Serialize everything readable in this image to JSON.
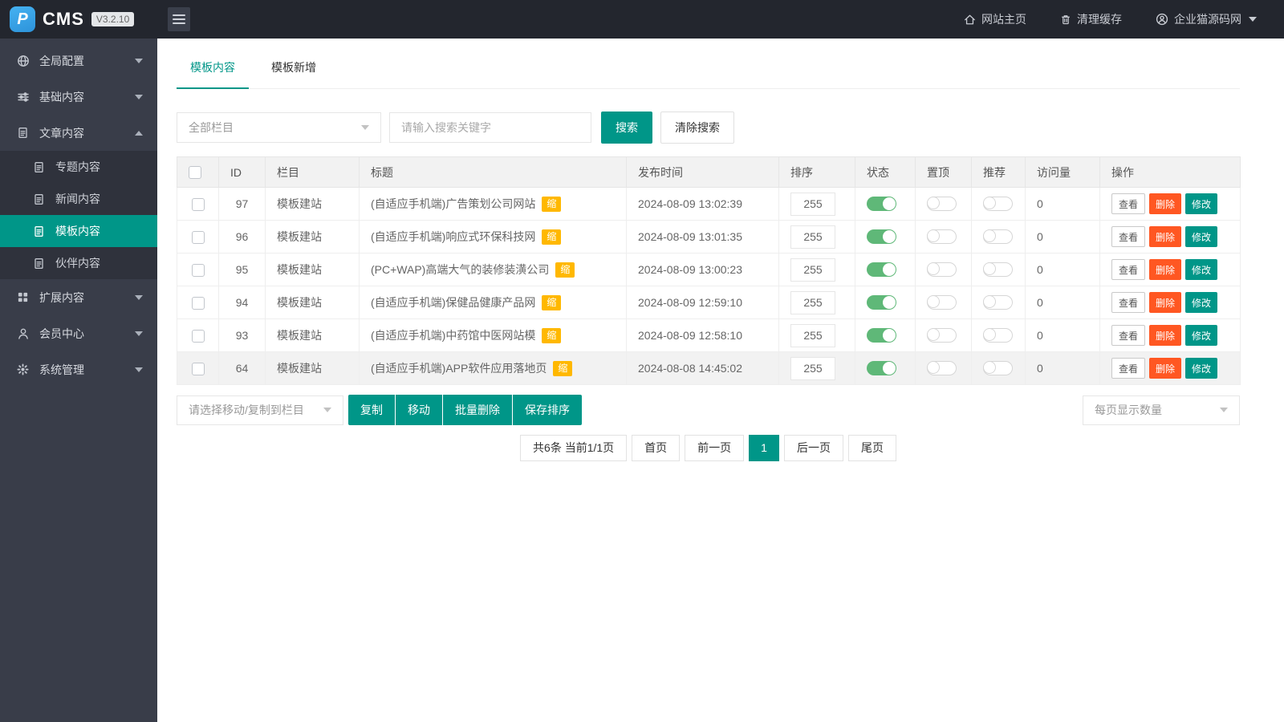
{
  "topbar": {
    "logo_letter": "P",
    "logo_text": "CMS",
    "version": "V3.2.10",
    "links": [
      {
        "label": "网站主页",
        "icon": "home-icon"
      },
      {
        "label": "清理缓存",
        "icon": "trash-icon"
      },
      {
        "label": "企业猫源码网",
        "icon": "user-circle-icon",
        "caret": true
      }
    ]
  },
  "sidebar": {
    "items": [
      {
        "label": "全局配置",
        "icon": "globe-icon",
        "caret": "down"
      },
      {
        "label": "基础内容",
        "icon": "sliders-icon",
        "caret": "down"
      },
      {
        "label": "文章内容",
        "icon": "file-icon",
        "caret": "up",
        "expanded": true,
        "children": [
          {
            "label": "专题内容",
            "icon": "file-icon"
          },
          {
            "label": "新闻内容",
            "icon": "file-icon"
          },
          {
            "label": "模板内容",
            "icon": "file-icon",
            "active": true
          },
          {
            "label": "伙伴内容",
            "icon": "file-icon"
          }
        ]
      },
      {
        "label": "扩展内容",
        "icon": "grid-icon",
        "caret": "down"
      },
      {
        "label": "会员中心",
        "icon": "user-icon",
        "caret": "down"
      },
      {
        "label": "系统管理",
        "icon": "gear-icon",
        "caret": "down"
      }
    ]
  },
  "tabs": [
    {
      "label": "模板内容",
      "active": true
    },
    {
      "label": "模板新增",
      "active": false
    }
  ],
  "filters": {
    "category_select_value": "全部栏目",
    "search_placeholder": "请输入搜索关键字",
    "search_button": "搜索",
    "clear_button": "清除搜索"
  },
  "table": {
    "columns": [
      "ID",
      "栏目",
      "标题",
      "发布时间",
      "排序",
      "状态",
      "置顶",
      "推荐",
      "访问量",
      "操作"
    ],
    "actions": [
      "查看",
      "删除",
      "修改"
    ],
    "rows": [
      {
        "id": "97",
        "category": "模板建站",
        "title": "(自适应手机端)广告策划公司网站",
        "badge": "缩",
        "time": "2024-08-09 13:02:39",
        "sort": "255",
        "status": true,
        "pinned": false,
        "recommended": false,
        "visits": "0",
        "highlighted": false
      },
      {
        "id": "96",
        "category": "模板建站",
        "title": "(自适应手机端)响应式环保科技网",
        "badge": "缩",
        "time": "2024-08-09 13:01:35",
        "sort": "255",
        "status": true,
        "pinned": false,
        "recommended": false,
        "visits": "0",
        "highlighted": false
      },
      {
        "id": "95",
        "category": "模板建站",
        "title": "(PC+WAP)高端大气的装修装潢公司",
        "badge": "缩",
        "time": "2024-08-09 13:00:23",
        "sort": "255",
        "status": true,
        "pinned": false,
        "recommended": false,
        "visits": "0",
        "highlighted": false
      },
      {
        "id": "94",
        "category": "模板建站",
        "title": "(自适应手机端)保健品健康产品网",
        "badge": "缩",
        "time": "2024-08-09 12:59:10",
        "sort": "255",
        "status": true,
        "pinned": false,
        "recommended": false,
        "visits": "0",
        "highlighted": false
      },
      {
        "id": "93",
        "category": "模板建站",
        "title": "(自适应手机端)中药馆中医网站模",
        "badge": "缩",
        "time": "2024-08-09 12:58:10",
        "sort": "255",
        "status": true,
        "pinned": false,
        "recommended": false,
        "visits": "0",
        "highlighted": false
      },
      {
        "id": "64",
        "category": "模板建站",
        "title": "(自适应手机端)APP软件应用落地页",
        "badge": "缩",
        "time": "2024-08-08 14:45:02",
        "sort": "255",
        "status": true,
        "pinned": false,
        "recommended": false,
        "visits": "0",
        "highlighted": true
      }
    ]
  },
  "bulkbar": {
    "select_placeholder": "请选择移动/复制到栏目",
    "buttons": [
      "复制",
      "移动",
      "批量删除",
      "保存排序"
    ],
    "pagesize_placeholder": "每页显示数量"
  },
  "pagination": {
    "summary": "共6条 当前1/1页",
    "pages": [
      {
        "label": "首页",
        "active": false
      },
      {
        "label": "前一页",
        "active": false
      },
      {
        "label": "1",
        "active": true
      },
      {
        "label": "后一页",
        "active": false
      },
      {
        "label": "尾页",
        "active": false
      }
    ]
  },
  "colors": {
    "accent_teal": "#009688",
    "toggle_on_green": "#5FB878",
    "delete_red": "#FF5722",
    "badge_yellow": "#FFB800",
    "topbar_bg": "#23262E",
    "sidebar_bg": "#393D49",
    "submenu_bg": "#2F323C",
    "table_header_bg": "#F2F2F2"
  }
}
